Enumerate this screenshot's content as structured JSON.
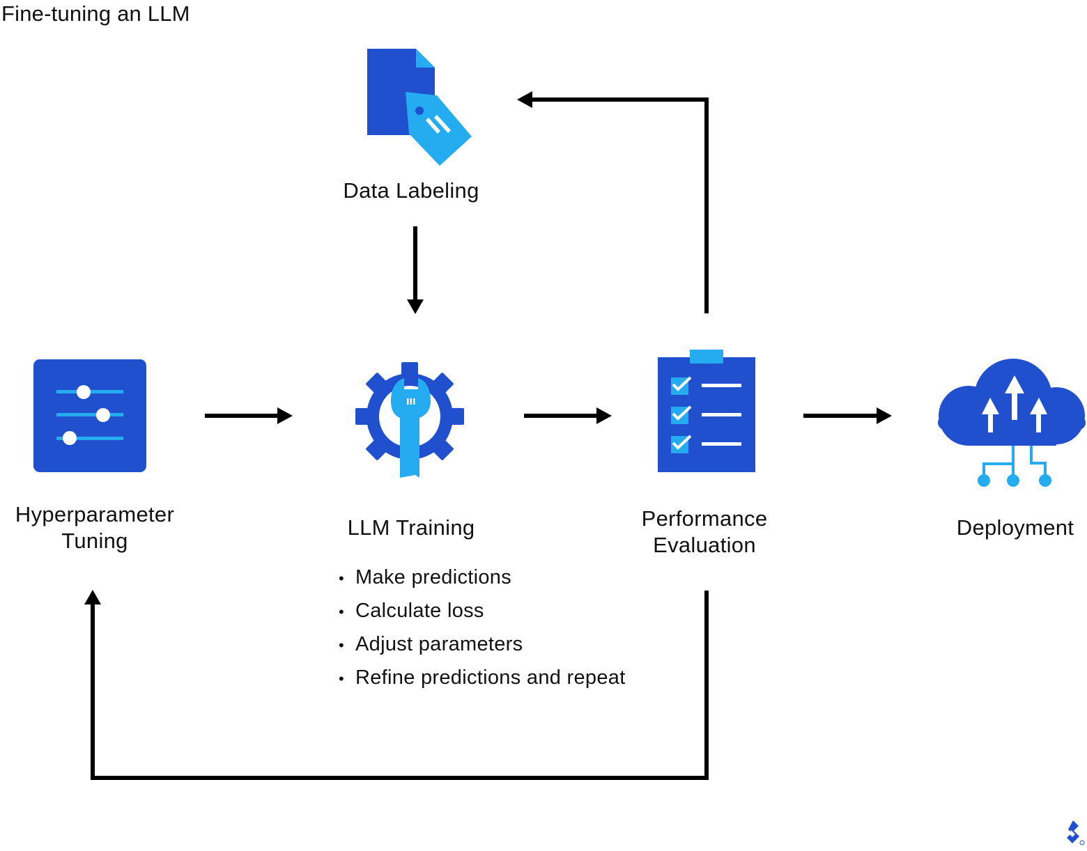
{
  "title": "Fine-tuning an LLM",
  "colors": {
    "primary_blue": "#2150CF",
    "accent_blue": "#25ABEF",
    "arrow": "#000000",
    "text": "#111111"
  },
  "nodes": {
    "data_labeling": {
      "label": "Data Labeling",
      "icon": "document-tag-icon"
    },
    "hyperparameter_tuning": {
      "label_line1": "Hyperparameter",
      "label_line2": "Tuning",
      "icon": "sliders-icon"
    },
    "llm_training": {
      "label": "LLM Training",
      "icon": "gear-wrench-icon",
      "bullet_char": "•",
      "steps": [
        "Make predictions",
        "Calculate loss",
        "Adjust parameters",
        "Refine predictions and repeat"
      ]
    },
    "performance_evaluation": {
      "label_line1": "Performance",
      "label_line2": "Evaluation",
      "icon": "clipboard-checklist-icon"
    },
    "deployment": {
      "label": "Deployment",
      "icon": "cloud-upload-icon"
    }
  },
  "edges": [
    {
      "from": "Data Labeling",
      "to": "LLM Training"
    },
    {
      "from": "Hyperparameter Tuning",
      "to": "LLM Training"
    },
    {
      "from": "LLM Training",
      "to": "Performance Evaluation"
    },
    {
      "from": "Performance Evaluation",
      "to": "Deployment"
    },
    {
      "from": "Performance Evaluation",
      "to": "Data Labeling"
    },
    {
      "from": "Performance Evaluation",
      "to": "Hyperparameter Tuning"
    }
  ],
  "brand_mark": "toptal-logo-icon"
}
